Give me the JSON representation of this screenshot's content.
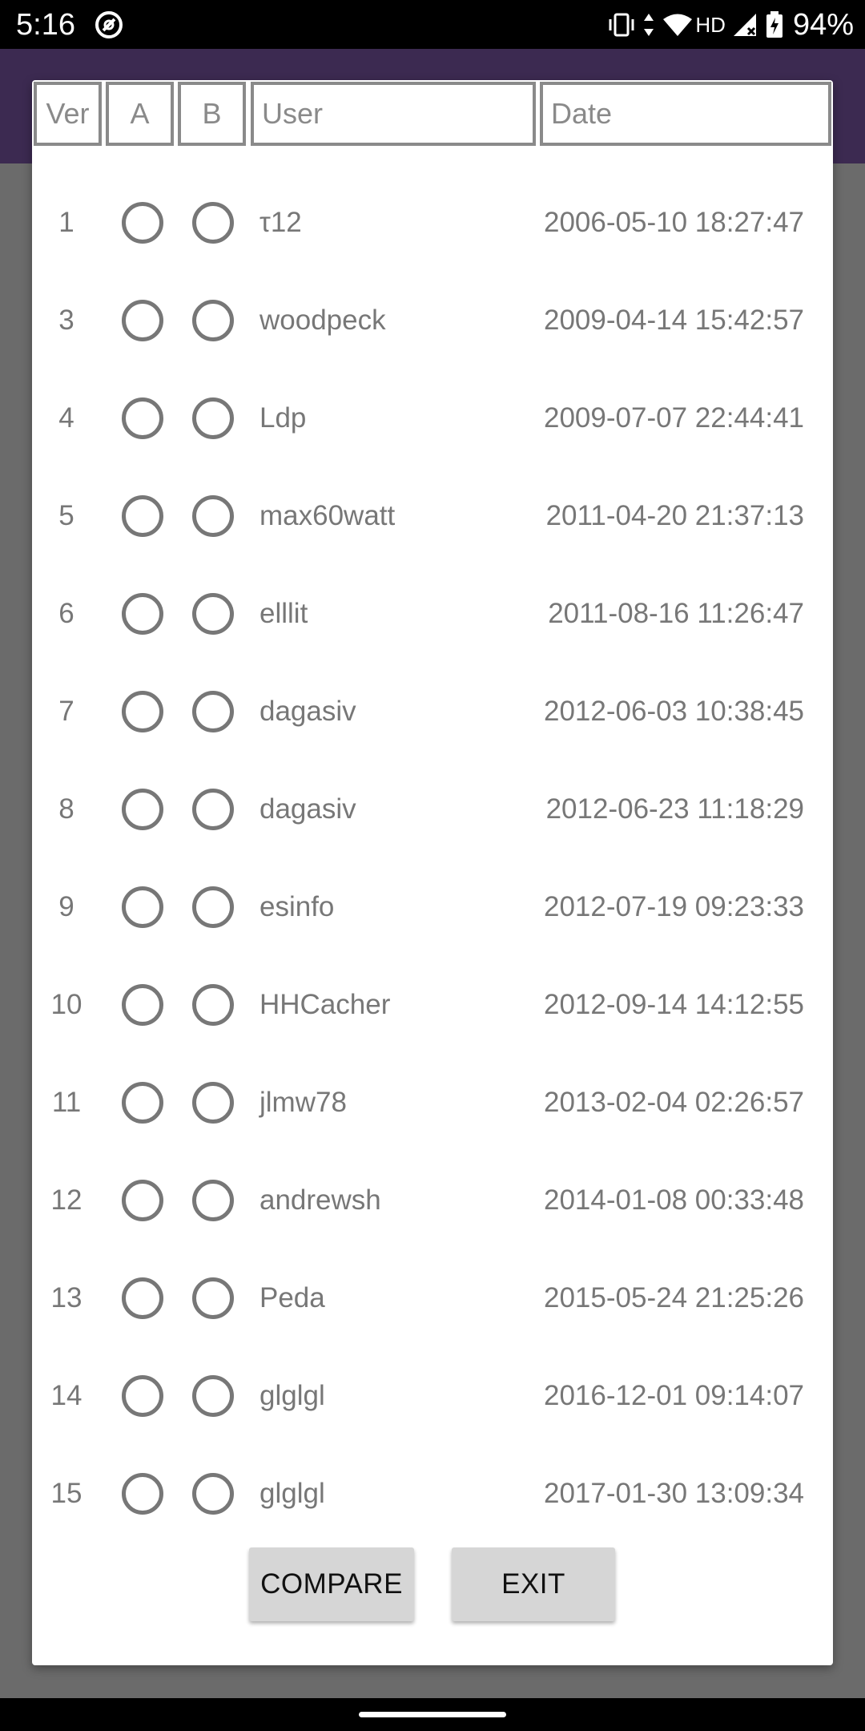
{
  "status_bar": {
    "time": "5:16",
    "network": "HD",
    "battery": "94%",
    "icons": [
      "app-notification-icon",
      "vibrate-icon",
      "data-arrows-icon",
      "wifi-icon",
      "signal-icon",
      "battery-charging-icon"
    ]
  },
  "table": {
    "headers": {
      "ver": "Ver",
      "a": "A",
      "b": "B",
      "user": "User",
      "date": "Date"
    },
    "rows": [
      {
        "ver": "1",
        "user": "τ12",
        "date": "2006-05-10 18:27:47",
        "a_selected": false,
        "b_selected": false
      },
      {
        "ver": "3",
        "user": "woodpeck",
        "date": "2009-04-14 15:42:57",
        "a_selected": false,
        "b_selected": false
      },
      {
        "ver": "4",
        "user": "Ldp",
        "date": "2009-07-07 22:44:41",
        "a_selected": false,
        "b_selected": false
      },
      {
        "ver": "5",
        "user": "max60watt",
        "date": "2011-04-20 21:37:13",
        "a_selected": false,
        "b_selected": false
      },
      {
        "ver": "6",
        "user": "elllit",
        "date": "2011-08-16 11:26:47",
        "a_selected": false,
        "b_selected": false
      },
      {
        "ver": "7",
        "user": "dagasiv",
        "date": "2012-06-03 10:38:45",
        "a_selected": false,
        "b_selected": false
      },
      {
        "ver": "8",
        "user": "dagasiv",
        "date": "2012-06-23 11:18:29",
        "a_selected": false,
        "b_selected": false
      },
      {
        "ver": "9",
        "user": "esinfo",
        "date": "2012-07-19 09:23:33",
        "a_selected": false,
        "b_selected": false
      },
      {
        "ver": "10",
        "user": "HHCacher",
        "date": "2012-09-14 14:12:55",
        "a_selected": false,
        "b_selected": false
      },
      {
        "ver": "11",
        "user": "jlmw78",
        "date": "2013-02-04 02:26:57",
        "a_selected": false,
        "b_selected": false
      },
      {
        "ver": "12",
        "user": "andrewsh",
        "date": "2014-01-08 00:33:48",
        "a_selected": false,
        "b_selected": false
      },
      {
        "ver": "13",
        "user": "Peda",
        "date": "2015-05-24 21:25:26",
        "a_selected": false,
        "b_selected": false
      },
      {
        "ver": "14",
        "user": "glglgl",
        "date": "2016-12-01 09:14:07",
        "a_selected": false,
        "b_selected": false
      },
      {
        "ver": "15",
        "user": "glglgl",
        "date": "2017-01-30 13:09:34",
        "a_selected": false,
        "b_selected": false
      }
    ]
  },
  "buttons": {
    "compare": "COMPARE",
    "exit": "EXIT"
  },
  "colors": {
    "app_bar": "#3c2a51",
    "scrim": "#6b6b6b",
    "text_secondary": "#777777",
    "button_bg": "#d6d6d6"
  }
}
